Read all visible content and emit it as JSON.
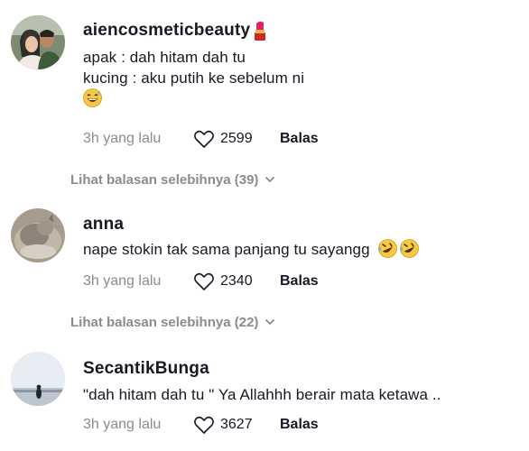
{
  "comments": [
    {
      "username": "aiencosmeticbeauty",
      "lines": [
        "apak : dah hitam dah tu",
        "kucing : aku putih ke sebelum ni"
      ],
      "time": "3h yang lalu",
      "likes": "2599",
      "reply_label": "Balas",
      "more_replies": "Lihat balasan selebihnya (39)"
    },
    {
      "username": "anna",
      "lines": [
        "nape stokin tak sama panjang tu sayangg"
      ],
      "time": "3h yang lalu",
      "likes": "2340",
      "reply_label": "Balas",
      "more_replies": "Lihat balasan selebihnya (22)"
    },
    {
      "username": "SecantikBunga",
      "lines": [
        "\"dah hitam dah tu \" Ya Allahhh berair mata ketawa .."
      ],
      "time": "3h yang lalu",
      "likes": "3627",
      "reply_label": "Balas"
    }
  ]
}
